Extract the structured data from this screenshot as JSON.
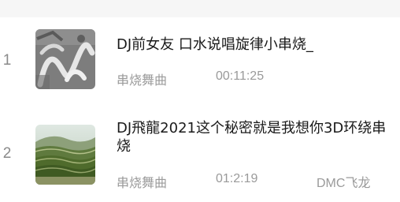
{
  "songs": [
    {
      "index": "1",
      "title": "DJ前女友  口水说唱旋律小串烧_",
      "artist": "串烧舞曲",
      "duration": "00:11:25",
      "uploader": ""
    },
    {
      "index": "2",
      "title": "DJ飛龍2021这个秘密就是我想你3D环绕串烧",
      "artist": "串烧舞曲",
      "duration": "01:2:19",
      "uploader": "DMC飞龙"
    }
  ],
  "icons": {
    "row1_thumb": "album-cover-graffiti",
    "row2_thumb": "album-cover-landscape"
  },
  "colors": {
    "title": "#1a1a1a",
    "meta": "#9a9a9a",
    "index": "#8a8a8a",
    "top_strip": "#f6f6f6"
  }
}
